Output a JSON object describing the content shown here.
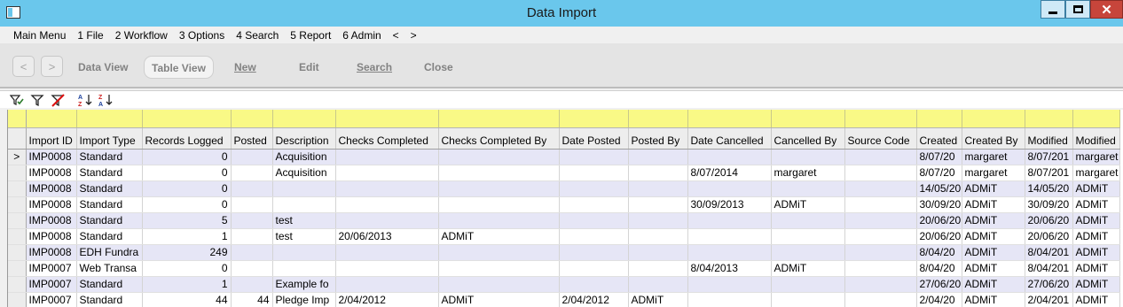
{
  "window": {
    "title": "Data Import"
  },
  "menu": [
    "Main Menu",
    "1 File",
    "2 Workflow",
    "3 Options",
    "4 Search",
    "5 Report",
    "6 Admin",
    "<",
    ">"
  ],
  "toolbar": {
    "back": "<",
    "forward": ">",
    "data_view": "Data View",
    "table_view": "Table View",
    "new": "New",
    "edit": "Edit",
    "search": "Search",
    "close": "Close"
  },
  "grid": {
    "columns": [
      "Import ID",
      "Import Type",
      "Records Logged",
      "Posted",
      "Description",
      "Checks Completed",
      "Checks Completed By",
      "Date Posted",
      "Posted By",
      "Date Cancelled",
      "Cancelled By",
      "Source Code",
      "Created",
      "Created By",
      "Modified",
      "Modified"
    ],
    "current_row_marker": ">",
    "rows": [
      [
        "IMP0008",
        "Standard",
        "0",
        "",
        "Acquisition",
        "",
        "",
        "",
        "",
        "",
        "",
        "",
        "8/07/20",
        "margaret",
        "8/07/201",
        "margaret"
      ],
      [
        "IMP0008",
        "Standard",
        "0",
        "",
        "Acquisition",
        "",
        "",
        "",
        "",
        "8/07/2014",
        "margaret",
        "",
        "8/07/20",
        "margaret",
        "8/07/201",
        "margaret"
      ],
      [
        "IMP0008",
        "Standard",
        "0",
        "",
        "",
        "",
        "",
        "",
        "",
        "",
        "",
        "",
        "14/05/20",
        "ADMiT",
        "14/05/20",
        "ADMiT"
      ],
      [
        "IMP0008",
        "Standard",
        "0",
        "",
        "",
        "",
        "",
        "",
        "",
        "30/09/2013",
        "ADMiT",
        "",
        "30/09/20",
        "ADMiT",
        "30/09/20",
        "ADMiT"
      ],
      [
        "IMP0008",
        "Standard",
        "5",
        "",
        "test",
        "",
        "",
        "",
        "",
        "",
        "",
        "",
        "20/06/20",
        "ADMiT",
        "20/06/20",
        "ADMiT"
      ],
      [
        "IMP0008",
        "Standard",
        "1",
        "",
        "test",
        "20/06/2013",
        "ADMiT",
        "",
        "",
        "",
        "",
        "",
        "20/06/20",
        "ADMiT",
        "20/06/20",
        "ADMiT"
      ],
      [
        "IMP0008",
        "EDH Fundra",
        "249",
        "",
        "",
        "",
        "",
        "",
        "",
        "",
        "",
        "",
        "8/04/20",
        "ADMiT",
        "8/04/201",
        "ADMiT"
      ],
      [
        "IMP0007",
        "Web Transa",
        "0",
        "",
        "",
        "",
        "",
        "",
        "",
        "8/04/2013",
        "ADMiT",
        "",
        "8/04/20",
        "ADMiT",
        "8/04/201",
        "ADMiT"
      ],
      [
        "IMP0007",
        "Standard",
        "1",
        "",
        "Example fo",
        "",
        "",
        "",
        "",
        "",
        "",
        "",
        "27/06/20",
        "ADMiT",
        "27/06/20",
        "ADMiT"
      ],
      [
        "IMP0007",
        "Standard",
        "44",
        "44",
        "Pledge Imp",
        "2/04/2012",
        "ADMiT",
        "2/04/2012",
        "ADMiT",
        "",
        "",
        "",
        "2/04/20",
        "ADMiT",
        "2/04/201",
        "ADMiT"
      ]
    ]
  },
  "filter_icons": [
    "filter-apply-icon",
    "filter-icon",
    "filter-clear-icon",
    "sort-ascending-icon",
    "sort-descending-icon"
  ],
  "colors": {
    "titlebar": "#6ac7ec",
    "filter_row": "#f9f986",
    "alt_row": "#e6e6f6",
    "close_button": "#c7453b"
  }
}
